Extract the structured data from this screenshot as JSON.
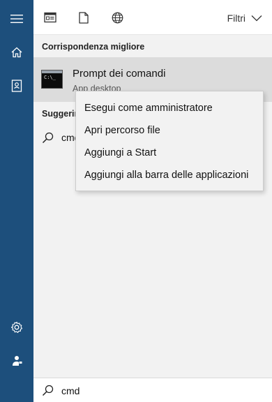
{
  "topbar": {
    "filters_label": "Filtri"
  },
  "best_match": {
    "header": "Corrispondenza migliore",
    "title": "Prompt dei comandi",
    "subtitle": "App desktop"
  },
  "suggestions": {
    "header": "Suggerimenti",
    "items": [
      {
        "label": "cmd"
      }
    ]
  },
  "context_menu": {
    "items": [
      {
        "label": "Esegui come amministratore"
      },
      {
        "label": "Apri percorso file"
      },
      {
        "label": "Aggiungi a Start"
      },
      {
        "label": "Aggiungi alla barra delle applicazioni"
      }
    ]
  },
  "search": {
    "value": "cmd"
  },
  "colors": {
    "rail": "#1d4f7c",
    "selected_row": "#dcdcdc",
    "panel": "#f2f2f2"
  },
  "icons": [
    "hamburger-icon",
    "home-icon",
    "notebook-icon",
    "settings-icon",
    "feedback-icon",
    "apps-icon",
    "documents-icon",
    "web-icon",
    "chevron-down-icon",
    "search-icon",
    "command-prompt-icon"
  ]
}
